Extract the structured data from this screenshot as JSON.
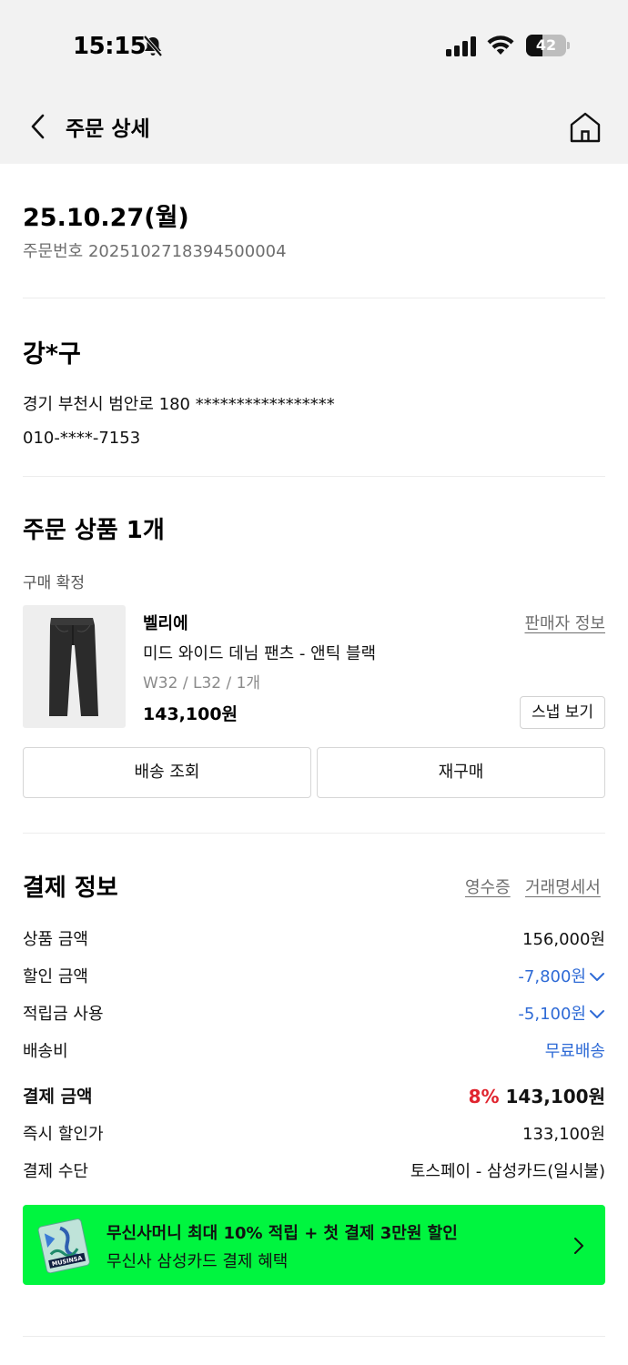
{
  "status_bar": {
    "time": "15:15",
    "battery": "42",
    "battery_level": 0.42
  },
  "nav": {
    "title": "주문 상세"
  },
  "order": {
    "date": "25.10.27(월)",
    "order_number": "주문번호 2025102718394500004"
  },
  "recipient": {
    "name": "강*구",
    "address": "경기 부천시 범안로 180 *****************",
    "phone": "010-****-7153"
  },
  "products_section": {
    "title": "주문 상품 1개",
    "status": "구매 확정",
    "item": {
      "brand": "벨리에",
      "seller_info_label": "판매자 정보",
      "name": "미드 와이드 데님 팬츠 - 앤틱 블랙",
      "option": "W32 / L32 / 1개",
      "price": "143,100원",
      "snap_label": "스냅 보기"
    },
    "track_button": "배송 조회",
    "reorder_button": "재구매"
  },
  "payment": {
    "title": "결제 정보",
    "receipt_link": "영수증",
    "statement_link": "거래명세서",
    "rows": {
      "product_amount": {
        "label": "상품 금액",
        "value": "156,000원"
      },
      "discount": {
        "label": "할인 금액",
        "value": "-7,800원"
      },
      "points": {
        "label": "적립금 사용",
        "value": "-5,100원"
      },
      "shipping": {
        "label": "배송비",
        "value": "무료배송"
      },
      "total": {
        "label": "결제 금액",
        "percent": "8%",
        "value": "143,100원"
      },
      "instant": {
        "label": "즉시 할인가",
        "value": "133,100원"
      },
      "method": {
        "label": "결제 수단",
        "value": "토스페이 - 삼성카드(일시불)"
      }
    }
  },
  "banner": {
    "line1": "무신사머니 최대 10% 적립 + 첫 결제 3만원 할인",
    "line2": "무신사 삼성카드 결제 혜택",
    "card_text": "MUSINSA",
    "color": "#00f53f"
  },
  "colors": {
    "accent_blue": "#2f6bd6",
    "accent_red": "#e0242e",
    "header_bg": "#f2f2f2"
  }
}
